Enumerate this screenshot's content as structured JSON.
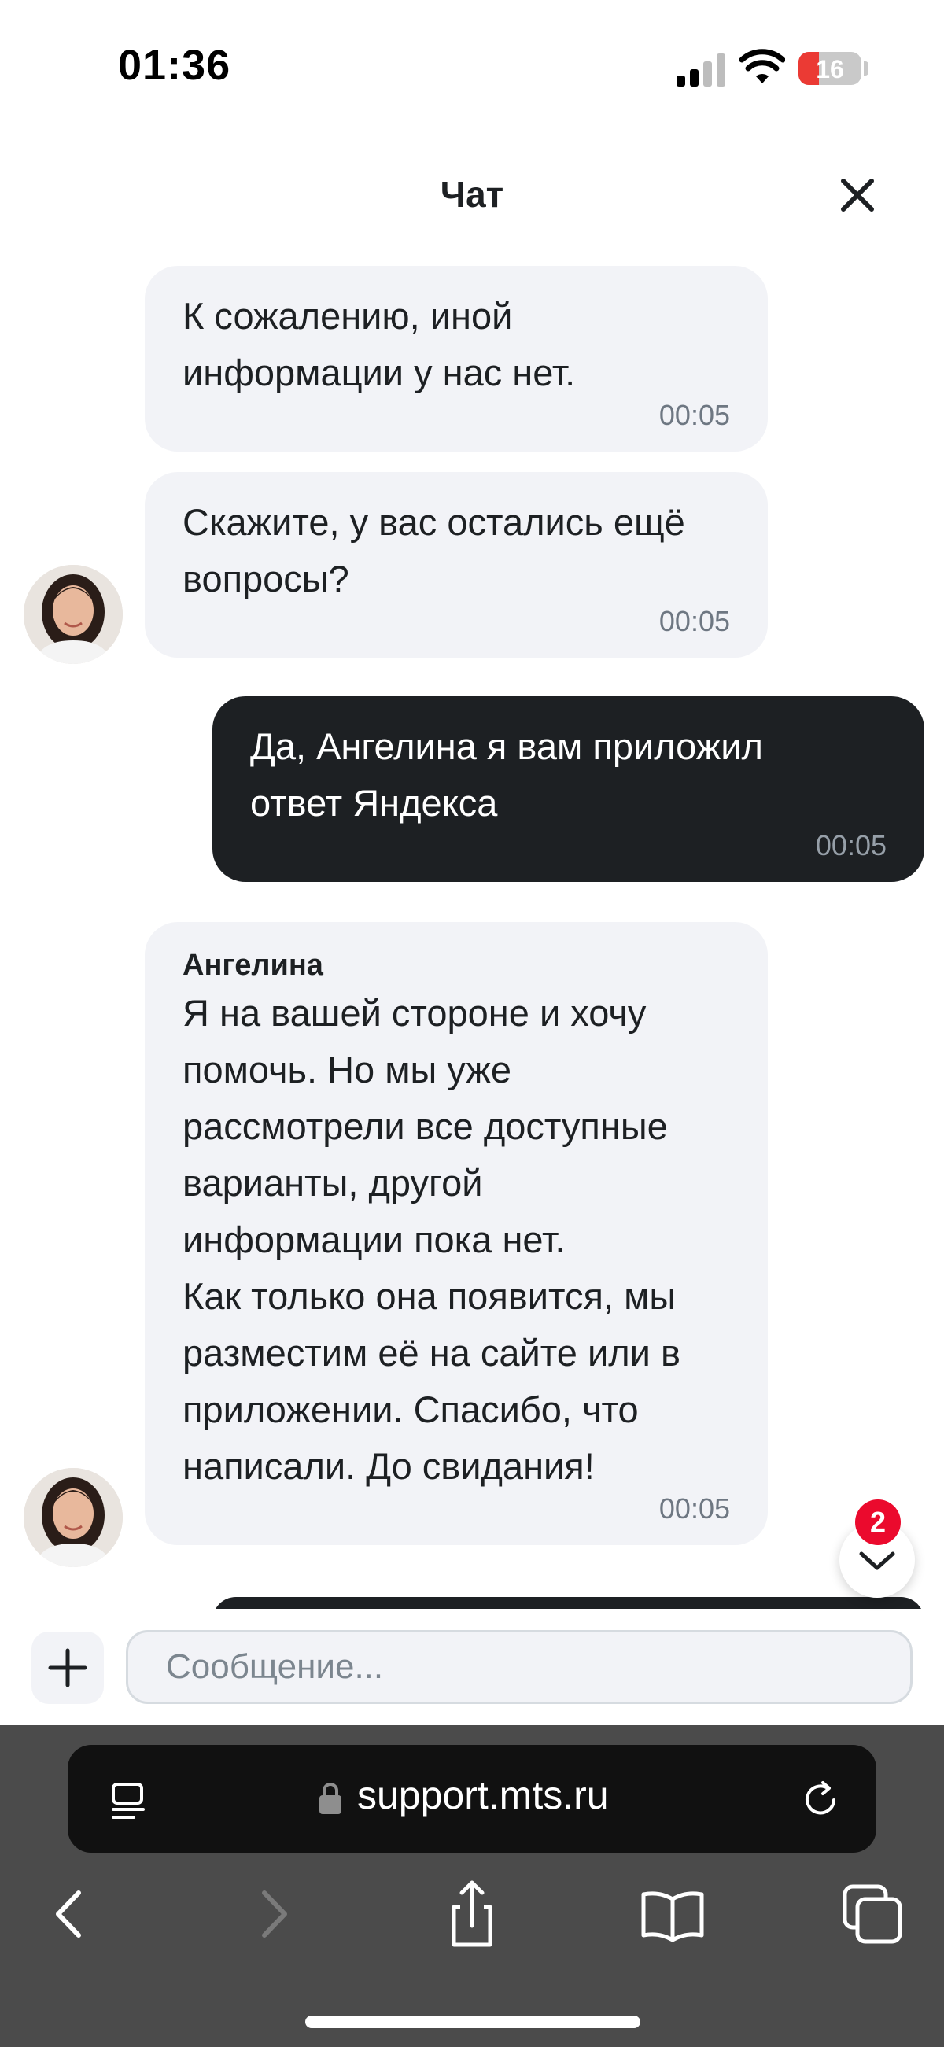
{
  "status_bar": {
    "time": "01:36",
    "battery": "16",
    "icons": [
      "signal-icon",
      "wifi-icon",
      "battery-icon"
    ]
  },
  "header": {
    "title": "Чат",
    "close_icon": "close-icon"
  },
  "messages": [
    {
      "direction": "in",
      "text": "К сожалению, иной\nинформации у нас нет.",
      "time": "00:05"
    },
    {
      "direction": "in",
      "text": "Скажите, у вас остались ещё\nвопросы?",
      "time": "00:05",
      "avatar": true
    },
    {
      "direction": "out",
      "text": "Да, Ангелина я вам приложил\nответ Яндекса",
      "time": "00:05"
    },
    {
      "direction": "in",
      "sender": "Ангелина",
      "text": "Я на вашей стороне и хочу\nпомочь. Но мы уже\nрассмотрели все доступные\nварианты, другой\nинформации пока нет.\nКак только она появится, мы\nразместим её на сайте или в\nприложении. Спасибо, что\nнаписали. До свидания!",
      "time": "00:05",
      "avatar": true
    }
  ],
  "scroll_button": {
    "badge": "2",
    "icon": "chevron-down-icon"
  },
  "composer": {
    "placeholder": "Сообщение...",
    "value": "",
    "attach_icon": "plus-icon"
  },
  "browser": {
    "url": "support.mts.ru",
    "icons": [
      "tabs-list-icon",
      "lock-icon",
      "reload-icon",
      "back-icon",
      "forward-icon",
      "share-icon",
      "bookmarks-icon",
      "tabs-icon"
    ]
  },
  "colors": {
    "incoming_bubble": "#f2f3f7",
    "outgoing_bubble": "#1d2023",
    "badge": "#eb0a2d",
    "browser_bar": "#4b4b4b"
  }
}
